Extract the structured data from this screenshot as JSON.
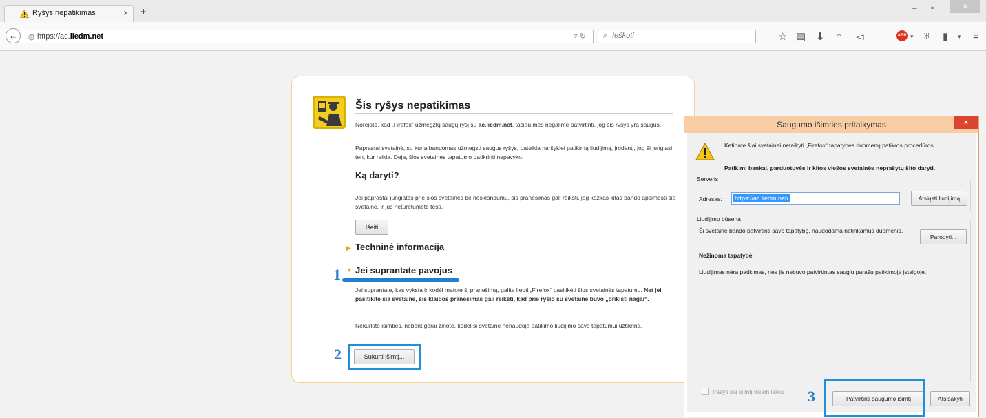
{
  "browser": {
    "tab_title": "Ryšys nepatikimas",
    "tab_close": "×",
    "new_tab": "+",
    "url_prefix": "https://ac.",
    "url_domain": "liedm.net",
    "search_placeholder": "Ieškoti",
    "window_controls": {
      "minimize": "–",
      "maximize": "▫",
      "close": "×"
    }
  },
  "page": {
    "title": "Šis ryšys nepatikimas",
    "intro_1": "Norėjote, kad „Firefox“ užmegztų saugų ryšį  su",
    "intro_domain": "ac.liedm.net",
    "intro_2": ", tačiau mes negalime patvirtinti, jog šis ryšys yra saugus.",
    "paragraph_2": "Paprastai svetainė, su kuria bandomas užmegzti saugus ryšys, pateikia naršyklei patikimą liudijimą, įrodantį, jog ši jungiasi ten, kur reikia. Deja, šios svetainės tapatumo patikrinti nepavyko.",
    "what_to_do_heading": "Ką daryti?",
    "what_to_do_text": "Jei paprastai jungiatės prie šios svetainės be nesklandumų, šis pranešimas gali reikšti, jog kažkas kitas bando apsimesti šia svetaine, ir jūs neturėtumėte tęsti.",
    "leave_button": "Išeiti",
    "technical_heading": "Techninė informacija",
    "understand_heading": "Jei suprantate pavojus",
    "understand_text_1": "Jei suprantate, kas vyksta ir kodėl matote šį pranešimą, galite liepti „Firefox“ pasitikėti šios svetainės tapatumu.",
    "understand_text_bold": "Net jei pasitikite šia svetaine, šis klaidos pranešimas gali reikšti, kad prie ryšio su svetaine buvo „prikišti nagai“.",
    "understand_text_2": "Nekurkite išimties, nebent gerai žinote, kodėl ši svetainė nenaudoja patikimo liudijimo savo tapatumui užtikrinti.",
    "add_exception_button": "Sukurti išimtį..."
  },
  "annotations": {
    "step1": "1",
    "step2": "2",
    "step3": "3"
  },
  "dialog": {
    "title": "Saugumo išimties pritaikymas",
    "close": "×",
    "warning_text": "Ketinate šiai svetainei netaikyti „Firefox“ tapatybės duomenų patikros procedūros.",
    "warning_bold": "Patikimi bankai, parduotuvės ir kitos viešos svetainės neprašytų šito daryti.",
    "server_group": "Serveris",
    "address_label": "Adresas:",
    "address_value": "https://ac.liedm.net/",
    "get_certificate_button": "Atsiųsti liudijimą",
    "status_group": "Liudijimo būsena",
    "status_text": "Ši svetainė bando patvirtinti savo tapatybę, naudodama netinkamus duomenis.",
    "view_button": "Parodyti...",
    "unknown_identity": "Nežinoma tapatybė",
    "untrusted_text": "Liudijimas nėra patikimas, nes jis nebuvo patvirtintas saugiu parašu patikimoje įstaigoje.",
    "permanent_checkbox": "Įrašyti šią išimtį visam laikui",
    "confirm_button": "Patvirtinti saugumo išimtį",
    "cancel_button": "Atsisakyti"
  },
  "colors": {
    "annotation_blue": "#1f90d8",
    "dialog_title": "#f8cda3",
    "card_border": "#f0d48a"
  }
}
